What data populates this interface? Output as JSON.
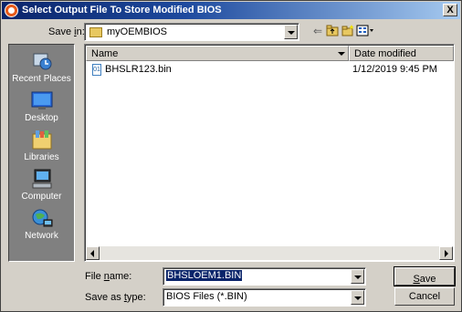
{
  "window": {
    "title": "Select Output File To Store Modified BIOS",
    "close_glyph": "X"
  },
  "save_in": {
    "label_prefix": "Save ",
    "label_accel": "i",
    "label_suffix": "n:",
    "value": "myOEMBIOS"
  },
  "toolbar": {
    "icons": [
      "back-arrow-icon",
      "up-folder-icon",
      "new-folder-icon",
      "view-menu-icon"
    ],
    "back_glyph": "⇐"
  },
  "places": [
    {
      "label": "Recent Places",
      "icon": "recent-places-icon"
    },
    {
      "label": "Desktop",
      "icon": "desktop-icon"
    },
    {
      "label": "Libraries",
      "icon": "libraries-icon"
    },
    {
      "label": "Computer",
      "icon": "computer-icon"
    },
    {
      "label": "Network",
      "icon": "network-icon"
    }
  ],
  "list": {
    "columns": [
      "Name",
      "Date modified"
    ],
    "files": [
      {
        "name": "BHSLR123.bin",
        "date": "1/12/2019 9:45 PM"
      }
    ]
  },
  "file_name": {
    "label_prefix": "File ",
    "label_accel": "n",
    "label_suffix": "ame:",
    "value": "BHSLOEM1.BIN"
  },
  "save_as_type": {
    "label_prefix": "Save as ",
    "label_accel": "t",
    "label_suffix": "ype:",
    "value": "BIOS Files (*.BIN)"
  },
  "buttons": {
    "save_accel": "S",
    "save_rest": "ave",
    "cancel": "Cancel"
  },
  "colors": {
    "title_bar": "#0a246a",
    "dialog_face": "#d4d0c8",
    "places_bar": "#808080"
  }
}
